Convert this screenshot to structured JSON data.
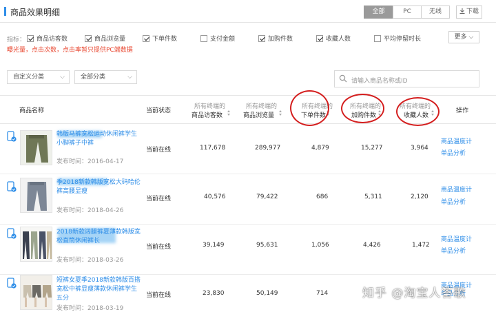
{
  "header": {
    "title": "商品效果明细",
    "segments": [
      "全部",
      "PC",
      "无线"
    ],
    "download_label": "下载"
  },
  "metrics": {
    "label": "指标：",
    "items": [
      {
        "label": "商品访客数",
        "checked": true
      },
      {
        "label": "商品浏览量",
        "checked": true
      },
      {
        "label": "下单件数",
        "checked": true
      },
      {
        "label": "支付金额",
        "checked": false
      },
      {
        "label": "加购件数",
        "checked": true
      },
      {
        "label": "收藏人数",
        "checked": true
      },
      {
        "label": "平均停留时长",
        "checked": false
      }
    ],
    "more_label": "更多",
    "notice": "曝光量，点击次数，点击率暂只提供PC端数据"
  },
  "filters": {
    "category1": "自定义分类",
    "category2": "全部分类",
    "search_placeholder": "请输入商品名称或ID"
  },
  "table": {
    "headers": {
      "name": "商品名称",
      "status": "当前状态",
      "range_prefix": "所有终端的",
      "visitors": "商品访客数",
      "pageviews": "商品浏览量",
      "orders": "下单件数",
      "cart": "加购件数",
      "favorites": "收藏人数",
      "ops": "操作"
    },
    "rows": [
      {
        "title": "韩版马裤宽松运动休闲裤学生小脚裤子中裤",
        "published": "发布时间：2016-04-17",
        "status": "当前在线",
        "visitors": "117,678",
        "pageviews": "289,977",
        "orders": "4,879",
        "cart": "15,277",
        "favorites": "3,964"
      },
      {
        "title": "季2018新款韩版宽松大码哈伦裤高腰显瘦",
        "published": "发布时间：2018-04-26",
        "status": "当前在线",
        "visitors": "40,576",
        "pageviews": "79,422",
        "orders": "686",
        "cart": "5,311",
        "favorites": "2,120"
      },
      {
        "title": "2018新款阔腿裤夏薄款韩版宽松直筒休闲裤长",
        "published": "发布时间：2018-03-26",
        "status": "当前在线",
        "visitors": "39,149",
        "pageviews": "95,631",
        "orders": "1,056",
        "cart": "4,426",
        "favorites": "1,472"
      },
      {
        "title": "短裤女夏季2018新款韩版百搭宽松中裤显瘦薄款休闲裤学生五分",
        "published": "发布时间：2018-03-19",
        "status": "当前在线",
        "visitors": "23,830",
        "pageviews": "50,149",
        "orders": "714",
        "cart": "",
        "favorites": ""
      }
    ],
    "op1": "商品温度计",
    "op2": "单品分析"
  },
  "watermark": "知乎 @淘宝人答歌",
  "colors": {
    "accent": "#2f8ee8",
    "notice": "#e8442d",
    "highlight_circle": "#d41f1f"
  }
}
